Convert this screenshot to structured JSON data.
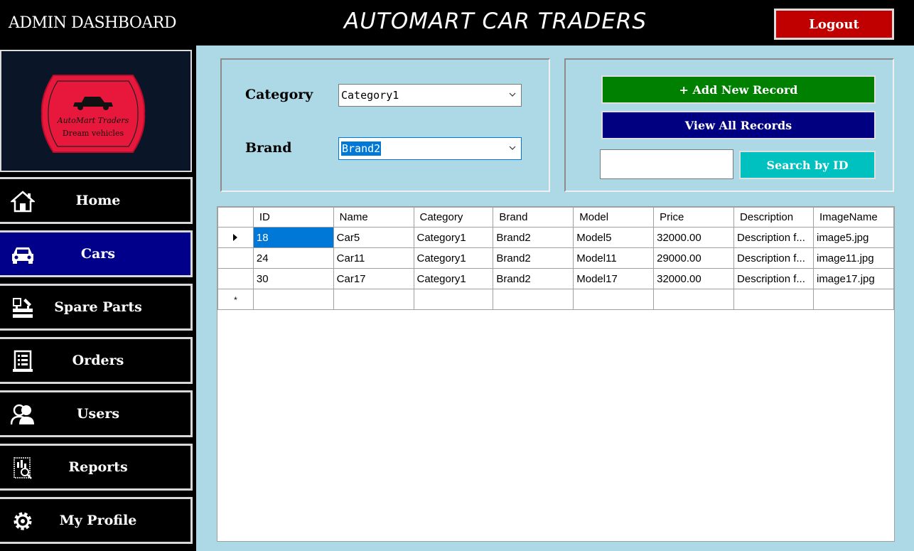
{
  "header": {
    "admin_title": "ADMIN DASHBOARD",
    "app_title": "AUTOMART CAR TRADERS",
    "logout_label": "Logout"
  },
  "logo": {
    "line1": "AutoMart Traders",
    "line2": "Dream vehicles",
    "color": "#e8183c"
  },
  "sidebar": {
    "items": [
      {
        "label": "Home",
        "icon": "home-icon"
      },
      {
        "label": "Cars",
        "icon": "car-icon",
        "active": true
      },
      {
        "label": "Spare Parts",
        "icon": "tools-icon"
      },
      {
        "label": "Orders",
        "icon": "orders-icon"
      },
      {
        "label": "Users",
        "icon": "users-icon"
      },
      {
        "label": "Reports",
        "icon": "reports-icon"
      },
      {
        "label": "My Profile",
        "icon": "gear-icon"
      }
    ]
  },
  "filters": {
    "category_label": "Category",
    "category_value": "Category1",
    "brand_label": "Brand",
    "brand_value": "Brand2"
  },
  "actions": {
    "add_label": "+ Add New Record",
    "view_label": "View All Records",
    "search_value": "",
    "search_label": "Search by ID"
  },
  "grid": {
    "columns": [
      "ID",
      "Name",
      "Category",
      "Brand",
      "Model",
      "Price",
      "Description",
      "ImageName"
    ],
    "rows": [
      [
        "18",
        "Car5",
        "Category1",
        "Brand2",
        "Model5",
        "32000.00",
        "Description f...",
        "image5.jpg"
      ],
      [
        "24",
        "Car11",
        "Category1",
        "Brand2",
        "Model11",
        "29000.00",
        "Description f...",
        "image11.jpg"
      ],
      [
        "30",
        "Car17",
        "Category1",
        "Brand2",
        "Model17",
        "32000.00",
        "Description f...",
        "image17.jpg"
      ]
    ],
    "new_row_marker": "*"
  },
  "colors": {
    "add": "#008000",
    "view": "#000080",
    "search": "#00c0c0",
    "logout": "#c00000",
    "active_nav": "#00008b",
    "main_bg": "#add8e6"
  }
}
